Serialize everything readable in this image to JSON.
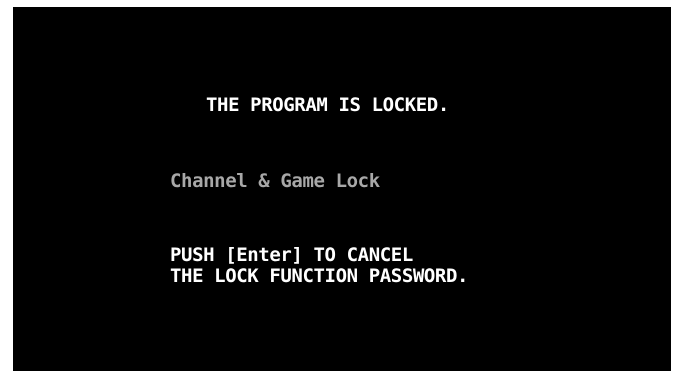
{
  "screen": {
    "title": "THE PROGRAM IS LOCKED.",
    "subtitle": "Channel & Game Lock",
    "message_lines": [
      "PUSH [Enter] TO CANCEL",
      "THE LOCK FUNCTION PASSWORD."
    ],
    "colors": {
      "background": "#000000",
      "text": "#ffffff",
      "subtitle": "#a8a8a8"
    }
  }
}
